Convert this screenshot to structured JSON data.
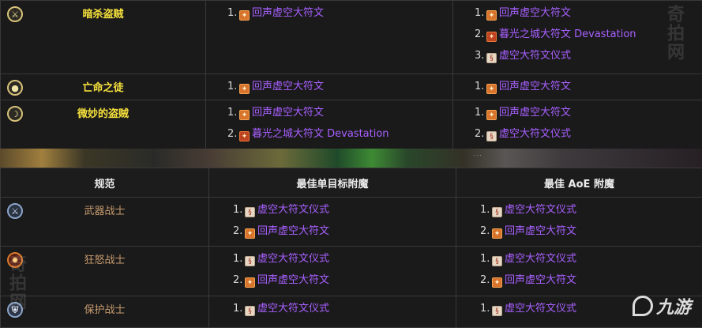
{
  "rogue_rows": [
    {
      "spec": "暗杀盗贼",
      "icon": "crossed-daggers-icon",
      "single": [
        {
          "num": "1.",
          "rune": "orange",
          "text": "回声虚空大符文"
        }
      ],
      "aoe": [
        {
          "num": "1.",
          "rune": "orange",
          "text": "回声虚空大符文"
        },
        {
          "num": "2.",
          "rune": "red",
          "text": "暮光之城大符文 Devastation"
        },
        {
          "num": "3.",
          "rune": "scroll",
          "text": "虚空大符文仪式"
        }
      ]
    },
    {
      "spec": "亡命之徒",
      "icon": "pistol-icon",
      "single": [
        {
          "num": "1.",
          "rune": "orange",
          "text": "回声虚空大符文"
        }
      ],
      "aoe": [
        {
          "num": "1.",
          "rune": "orange",
          "text": "回声虚空大符文"
        }
      ]
    },
    {
      "spec": "微妙的盗贼",
      "icon": "shadow-cloak-icon",
      "single": [
        {
          "num": "1.",
          "rune": "orange",
          "text": "回声虚空大符文"
        },
        {
          "num": "2.",
          "rune": "red",
          "text": "暮光之城大符文 Devastation"
        }
      ],
      "aoe": [
        {
          "num": "1.",
          "rune": "orange",
          "text": "回声虚空大符文"
        },
        {
          "num": "2.",
          "rune": "scroll",
          "text": "虚空大符文仪式"
        }
      ]
    }
  ],
  "warrior_header": {
    "spec": "规范",
    "single": "最佳单目标附魔",
    "aoe": "最佳 AoE 附魔"
  },
  "warrior_rows": [
    {
      "spec": "武器战士",
      "icon": "sword-icon",
      "single": [
        {
          "num": "1.",
          "rune": "scroll",
          "text": "虚空大符文仪式"
        },
        {
          "num": "2.",
          "rune": "orange",
          "text": "回声虚空大符文"
        }
      ],
      "aoe": [
        {
          "num": "1.",
          "rune": "scroll",
          "text": "虚空大符文仪式"
        },
        {
          "num": "2.",
          "rune": "orange",
          "text": "回声虚空大符文"
        }
      ]
    },
    {
      "spec": "狂怒战士",
      "icon": "fury-icon",
      "single": [
        {
          "num": "1.",
          "rune": "scroll",
          "text": "虚空大符文仪式"
        },
        {
          "num": "2.",
          "rune": "orange",
          "text": "回声虚空大符文"
        }
      ],
      "aoe": [
        {
          "num": "1.",
          "rune": "scroll",
          "text": "虚空大符文仪式"
        },
        {
          "num": "2.",
          "rune": "orange",
          "text": "回声虚空大符文"
        }
      ]
    },
    {
      "spec": "保护战士",
      "icon": "shield-icon",
      "single": [
        {
          "num": "1.",
          "rune": "scroll",
          "text": "虚空大符文仪式"
        }
      ],
      "aoe": [
        {
          "num": "1.",
          "rune": "scroll",
          "text": "虚空大符文仪式"
        }
      ]
    }
  ],
  "watermark": {
    "site": "奇拍网",
    "logo_text": "九游"
  },
  "colors": {
    "rogue": "#f7e23c",
    "warrior": "#c69b6d",
    "link": "#a760ff"
  }
}
